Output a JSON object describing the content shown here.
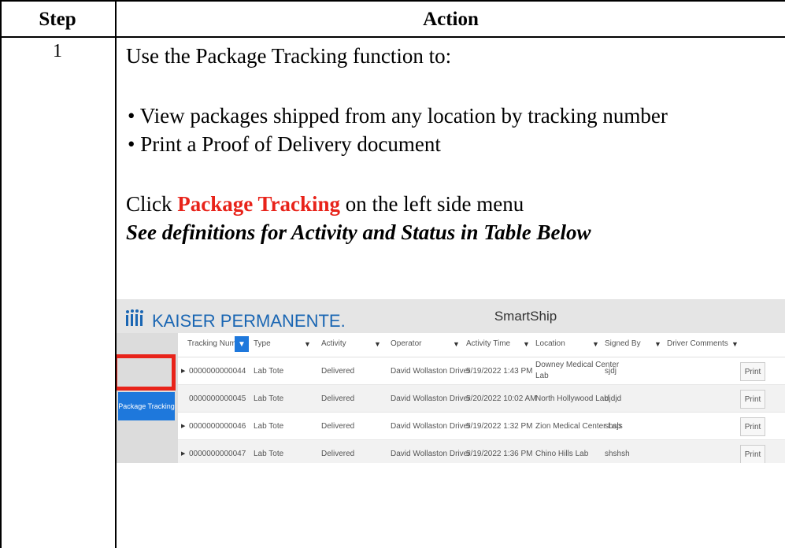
{
  "table": {
    "header_step": "Step",
    "header_action": "Action",
    "step_number": "1",
    "intro": "Use the Package Tracking function to:",
    "bullets": [
      "View packages shipped from any location by tracking number",
      "Print a Proof of Delivery document"
    ],
    "click_prefix": "Click ",
    "click_highlight": "Package Tracking",
    "click_suffix": " on the left side menu",
    "note": "See definitions for Activity and Status in Table Below",
    "highlight_color": "#e8231a"
  },
  "app": {
    "logo_text": "KAISER PERMANENTE.",
    "title": "SmartShip",
    "sidebar_item": "Package Tracking",
    "accent": "#1e78dc",
    "columns": [
      "Tracking Number",
      "Type",
      "Activity",
      "Operator",
      "Activity Time",
      "Location",
      "Signed By",
      "Driver Comments"
    ],
    "rows": [
      {
        "tracking": "0000000000044",
        "type": "Lab Tote",
        "activity": "Delivered",
        "operator": "David Wollaston Driver",
        "time": "5/19/2022 1:43 PM",
        "location": "Downey Medical Center",
        "location2": "Lab",
        "signed": "sjdj",
        "comments": "",
        "print": "Print"
      },
      {
        "tracking": "0000000000045",
        "type": "Lab Tote",
        "activity": "Delivered",
        "operator": "David Wollaston Driver",
        "time": "5/20/2022 10:02 AM",
        "location": "North Hollywood Lab",
        "location2": "",
        "signed": "djdjd",
        "comments": "",
        "print": "Print"
      },
      {
        "tracking": "0000000000046",
        "type": "Lab Tote",
        "activity": "Delivered",
        "operator": "David Wollaston Driver",
        "time": "5/19/2022 1:32 PM",
        "location": "Zion Medical Center Lab",
        "location2": "",
        "signed": "shsjs",
        "comments": "",
        "print": "Print"
      },
      {
        "tracking": "0000000000047",
        "type": "Lab Tote",
        "activity": "Delivered",
        "operator": "David Wollaston Driver",
        "time": "5/19/2022 1:36 PM",
        "location": "Chino Hills Lab",
        "location2": "",
        "signed": "shshsh",
        "comments": "",
        "print": "Print"
      }
    ]
  }
}
